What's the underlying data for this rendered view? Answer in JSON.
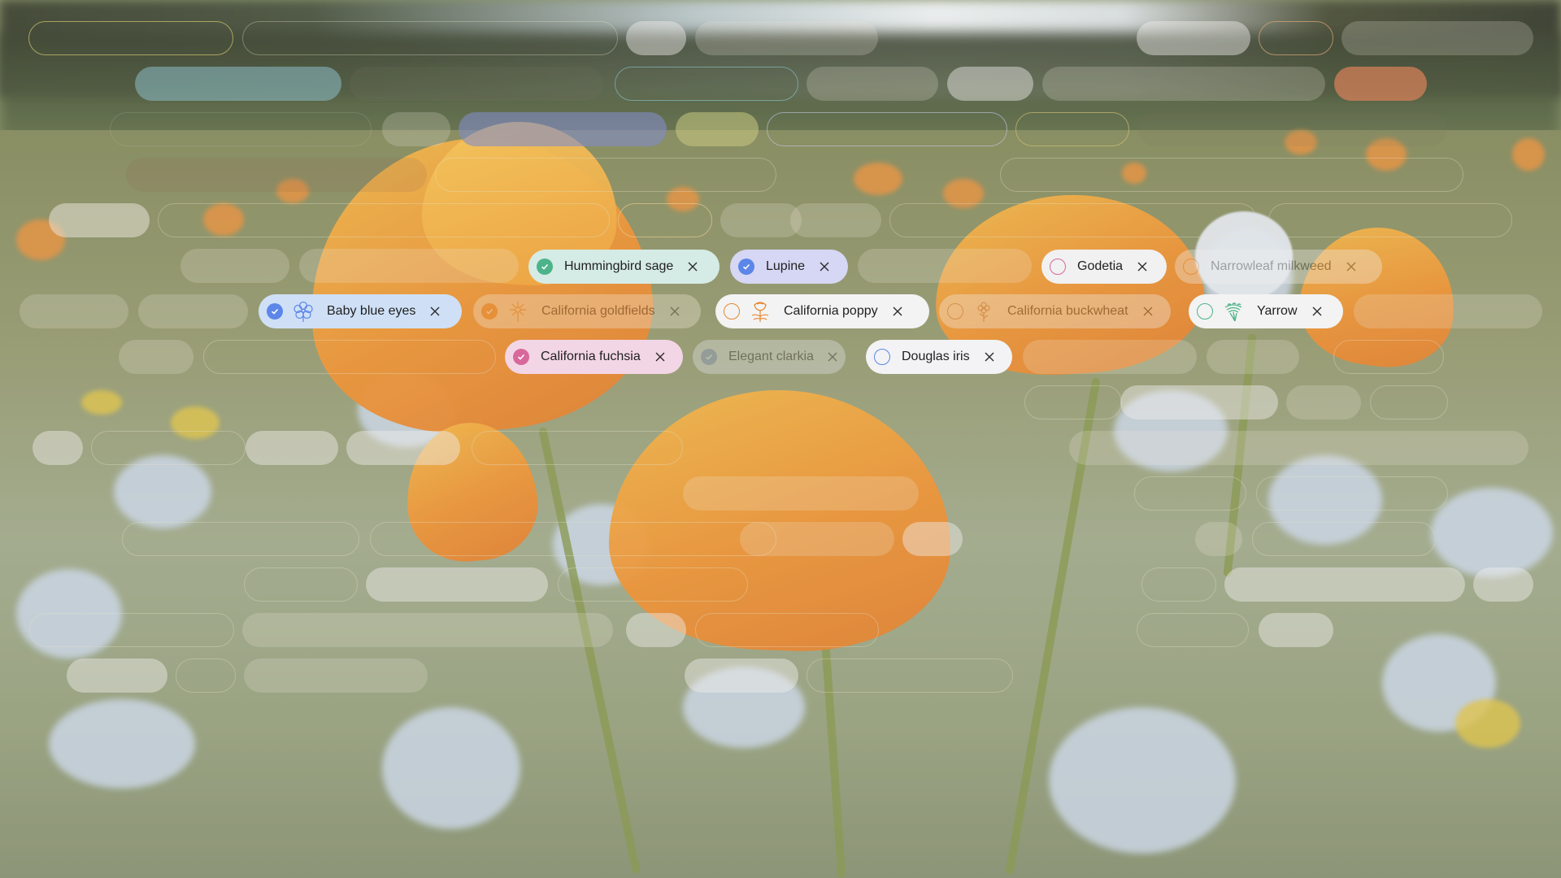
{
  "chips": [
    {
      "label": "Hummingbird sage",
      "selected": true,
      "faded": false,
      "bg": "#d5ebe5",
      "accent": "#4db38a",
      "icon": "none"
    },
    {
      "label": "Lupine",
      "selected": true,
      "faded": false,
      "bg": "#d6d7f4",
      "accent": "#5c86e8",
      "icon": "none"
    },
    {
      "label": "Godetia",
      "selected": false,
      "faded": false,
      "bg": "#f1f1f1",
      "accent": "#d8689b",
      "icon": "none"
    },
    {
      "label": "Narrowleaf milkweed",
      "selected": false,
      "faded": true,
      "bg": "#f1f1f1",
      "accent": "#e6872f",
      "icon": "none"
    },
    {
      "label": "Baby blue eyes",
      "selected": true,
      "faded": false,
      "bg": "#cfe0f6",
      "accent": "#5c86e8",
      "icon": "baby-blue-eyes-flower-icon"
    },
    {
      "label": "California goldfields",
      "selected": true,
      "faded": true,
      "bg": "#f1e7d5",
      "accent": "#e6872f",
      "icon": "goldfields-flower-icon"
    },
    {
      "label": "California poppy",
      "selected": false,
      "faded": false,
      "bg": "#f3f3f3",
      "accent": "#e6872f",
      "icon": "poppy-flower-icon"
    },
    {
      "label": "California buckwheat",
      "selected": false,
      "faded": true,
      "bg": "#f1f1f1",
      "accent": "#b07a5a",
      "icon": "buckwheat-flower-icon"
    },
    {
      "label": "Yarrow",
      "selected": false,
      "faded": false,
      "bg": "#f3f3f3",
      "accent": "#4db38a",
      "icon": "yarrow-flower-icon"
    },
    {
      "label": "California fuchsia",
      "selected": true,
      "faded": false,
      "bg": "#f3d6e6",
      "accent": "#d8689b",
      "icon": "none"
    },
    {
      "label": "Elegant clarkia",
      "selected": true,
      "faded": true,
      "bg": "#e8e8ef",
      "accent": "#8a9ad6",
      "icon": "none"
    },
    {
      "label": "Douglas iris",
      "selected": false,
      "faded": false,
      "bg": "#f3f3f5",
      "accent": "#5c86e8",
      "icon": "none"
    }
  ],
  "remove_icon": "close-icon",
  "selected_icon": "checkmark-icon"
}
